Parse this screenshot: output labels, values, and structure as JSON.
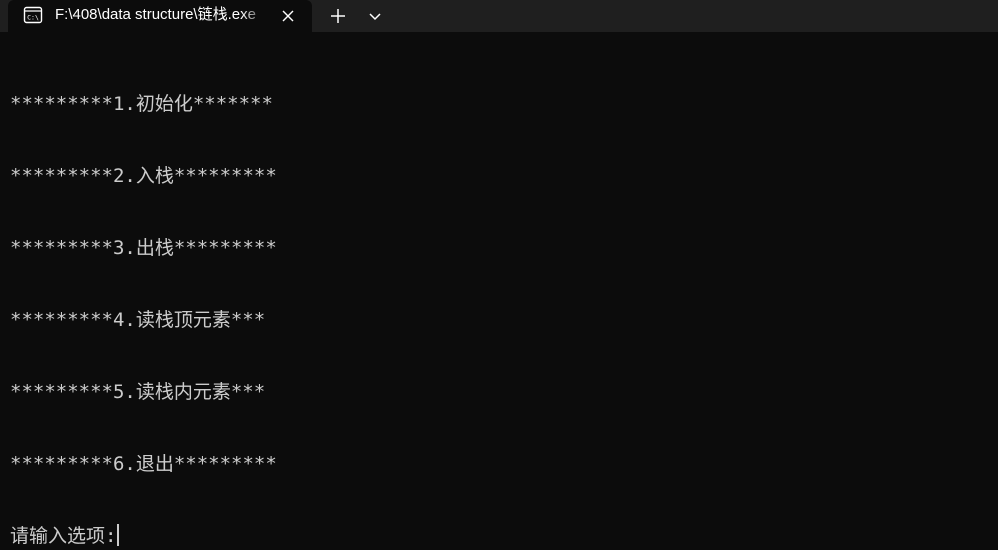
{
  "tab": {
    "title": "F:\\408\\data structure\\链栈.exe",
    "icon": "terminal-icon"
  },
  "tabbar": {
    "new_tab_icon": "plus-icon",
    "dropdown_icon": "chevron-down-icon",
    "close_icon": "close-icon"
  },
  "terminal": {
    "lines": [
      "*********1.初始化*******",
      "*********2.入栈*********",
      "*********3.出栈*********",
      "*********4.读栈顶元素***",
      "*********5.读栈内元素***",
      "*********6.退出*********"
    ],
    "prompt": "请输入选项:"
  },
  "colors": {
    "background": "#0c0c0c",
    "tabbar": "#1f1f1f",
    "text": "#cccccc"
  }
}
